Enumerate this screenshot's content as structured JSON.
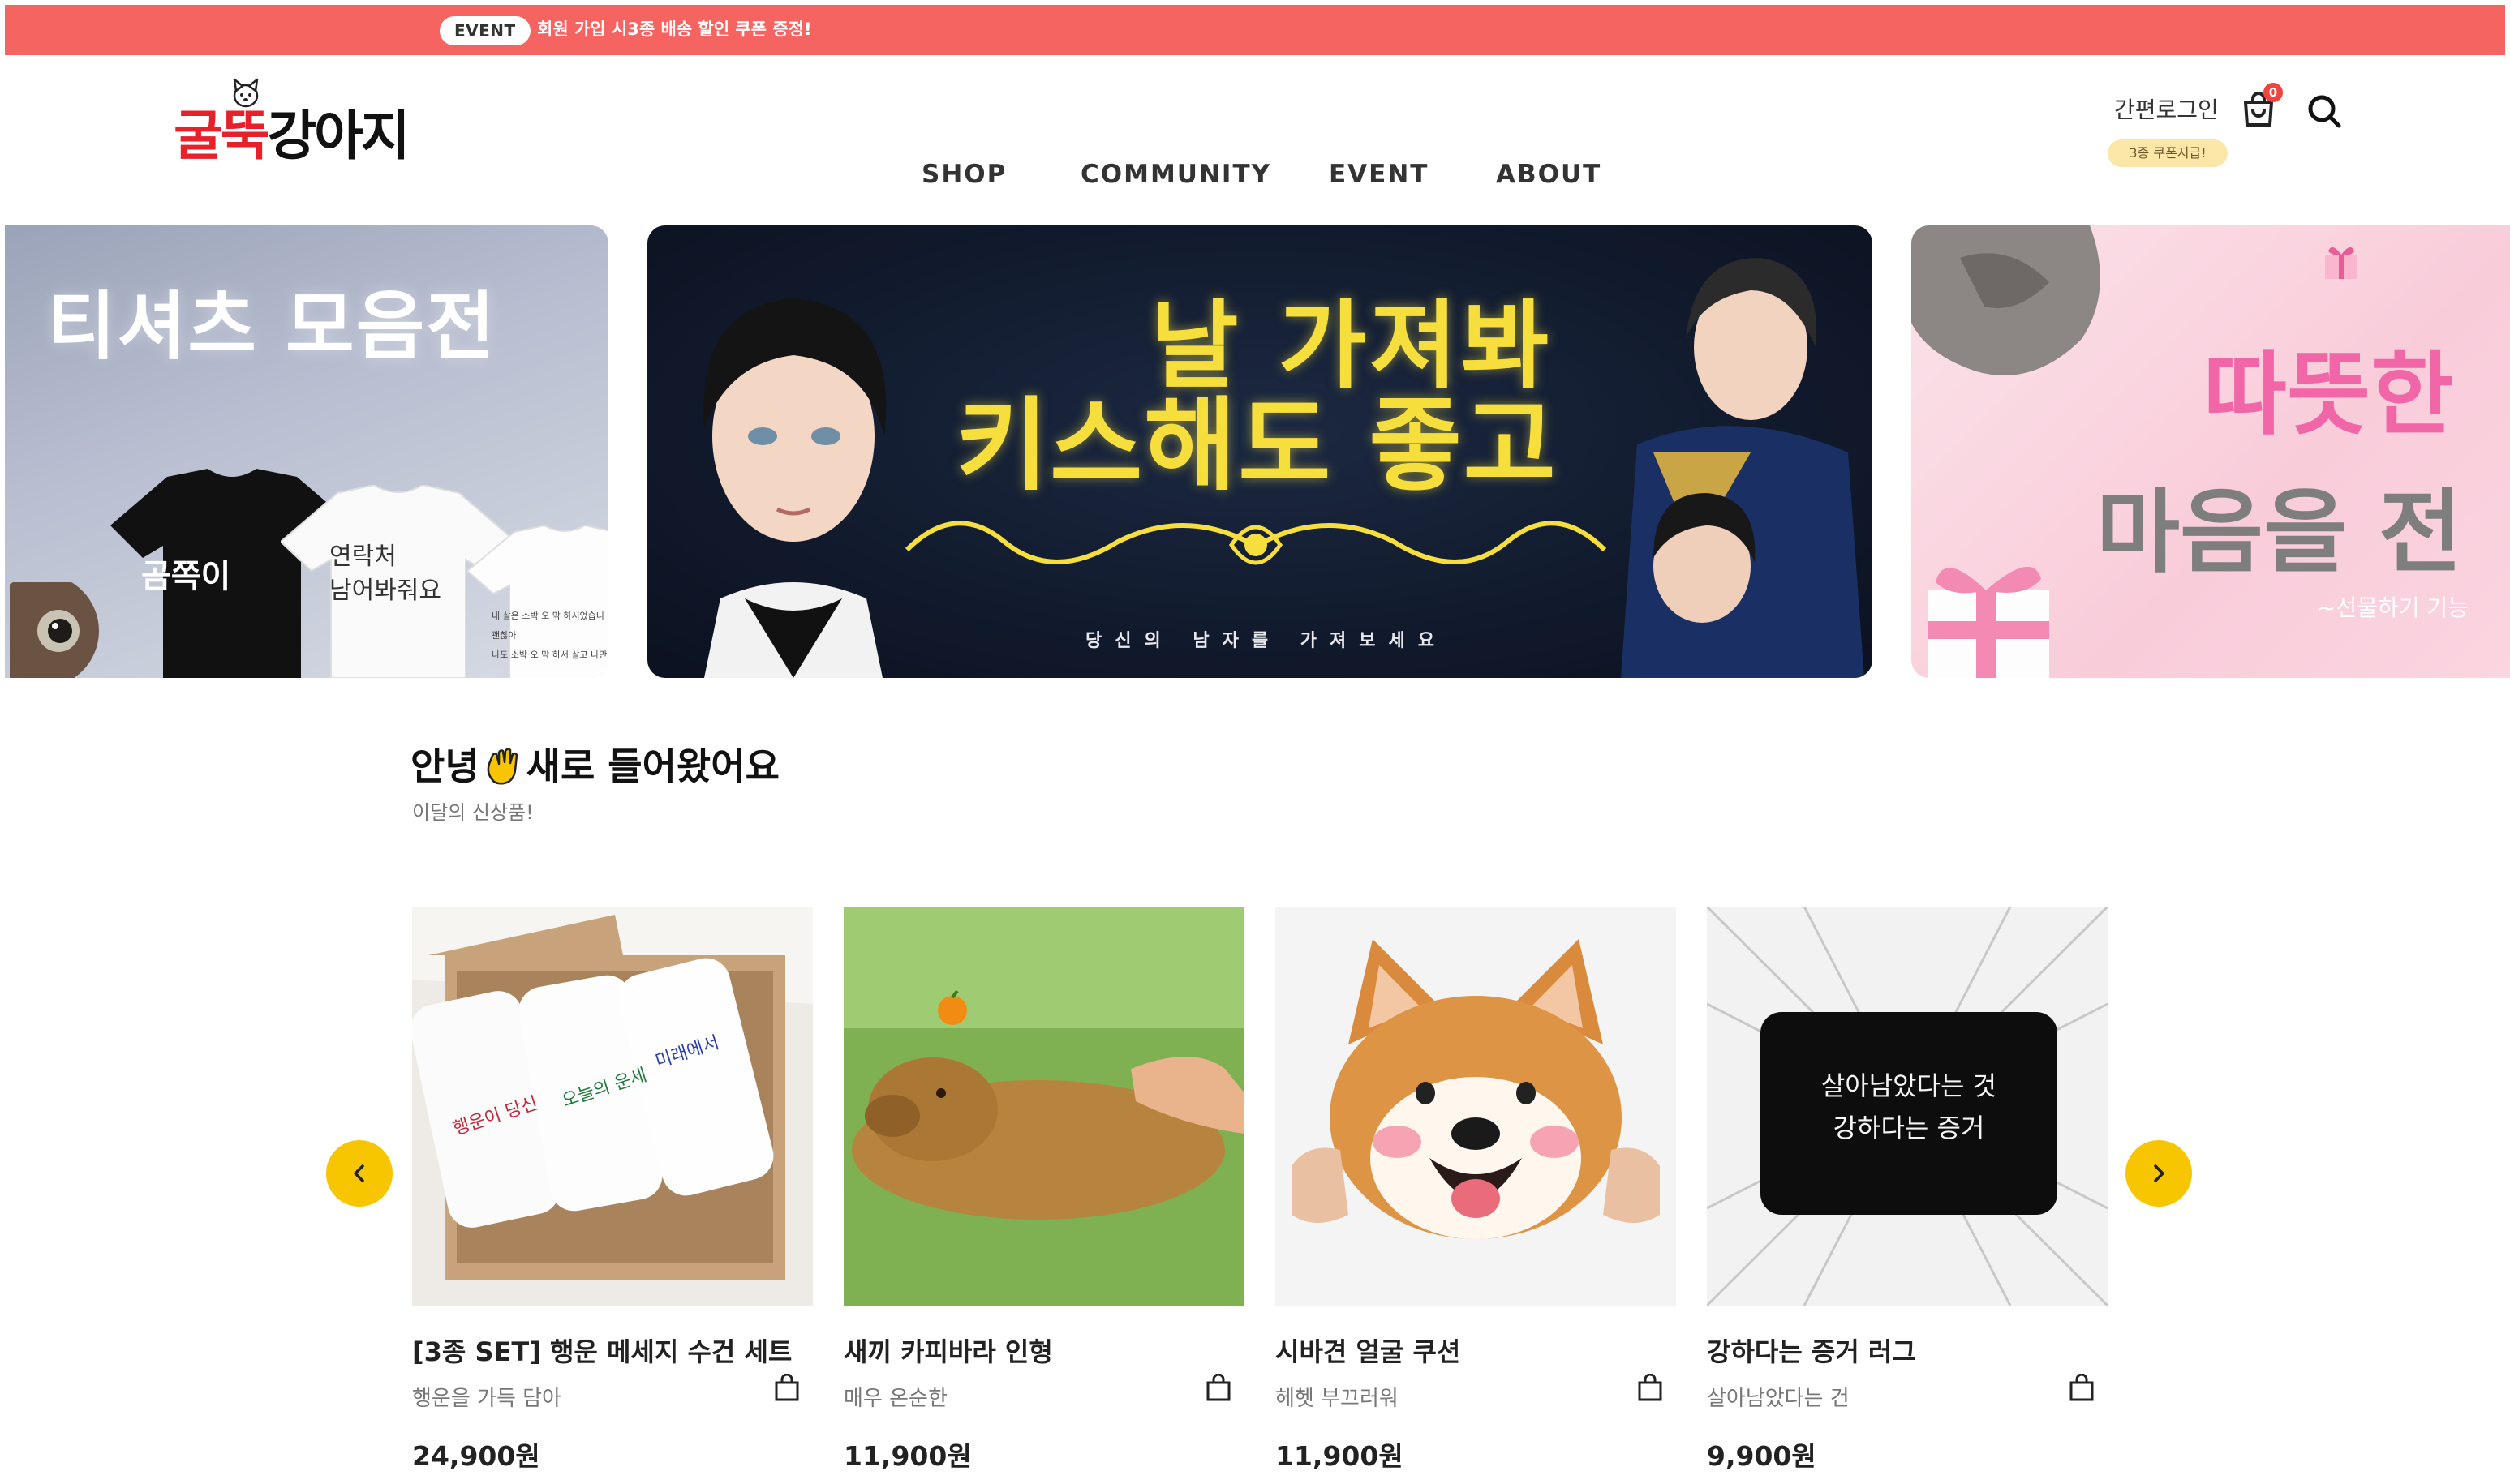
{
  "event_bar": {
    "badge": "EVENT",
    "text": "회원 가입 시3종 배송 할인 쿠폰 증정!",
    "color": "#f66462"
  },
  "header": {
    "logo": {
      "part_red": "굴뚝",
      "part_dark": "강아지"
    },
    "nav": [
      "SHOP",
      "COMMUNITY",
      "EVENT",
      "ABOUT"
    ],
    "login_label": "간편로그인",
    "coupon_label": "3종 쿠폰지급!",
    "cart_count": "0"
  },
  "banners": {
    "left": {
      "title": "티셔츠 모음전",
      "shirt_black_text": "곰쪽이",
      "shirt_white_text_1": "연락처",
      "shirt_white_text_2": "남어봐줘요",
      "small_text_1": "내 살은 소박 오 막 하시었습니",
      "small_text_2": "괜찮아",
      "small_text_3": "나도 소박 오 막 하서 살고 나만"
    },
    "center": {
      "line1": "날 가져봐",
      "line2": "키스해도 좋고",
      "subtitle": "당신의 남자를 가져보세요",
      "accent_color": "#f6df3d"
    },
    "right": {
      "line1": "따뜻한",
      "line2": "마음을 전",
      "subtitle": "~선물하기 기능"
    }
  },
  "section": {
    "title_before": "안녕",
    "title_after": "새로 들어왔어요",
    "subtitle": "이달의 신상품!"
  },
  "products": [
    {
      "name": "[3종 SET] 행운 메세지 수건 세트",
      "desc": "행운을 가득 담아",
      "price": "24,900원",
      "towel_texts": [
        "행운이 당신",
        "오늘의 운세",
        "미래에서"
      ]
    },
    {
      "name": "새끼 카피바라 인형",
      "desc": "매우 온순한",
      "price": "11,900원"
    },
    {
      "name": "시바견 얼굴 쿠션",
      "desc": "헤헷 부끄러워",
      "price": "11,900원"
    },
    {
      "name": "강하다는 증거 러그",
      "desc": "살아남았다는 건",
      "price": "9,900원",
      "rug_line1": "살아남았다는 것",
      "rug_line2": "강하다는 증거"
    }
  ],
  "icons": {
    "cart": "cart-icon",
    "search": "search-icon",
    "prev": "chevron-left-icon",
    "next": "chevron-right-icon",
    "bag": "shopping-bag-icon",
    "wave": "waving-hand-icon"
  },
  "colors": {
    "accent_yellow": "#f7c600",
    "badge_red": "#f0443e"
  }
}
